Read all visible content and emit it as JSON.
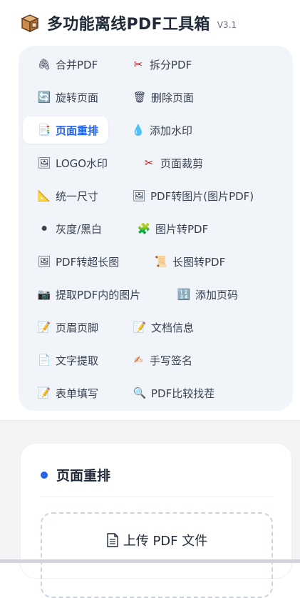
{
  "app": {
    "title": "多功能离线PDF工具箱",
    "version": "V3.1"
  },
  "tools": [
    {
      "label": "合并PDF",
      "icon": "paperclip-icon",
      "glyph": "🖇"
    },
    {
      "label": "拆分PDF",
      "icon": "scissors-icon",
      "glyph": "✂"
    },
    {
      "label": "旋转页面",
      "icon": "rotate-icon",
      "glyph": "🔄"
    },
    {
      "label": "删除页面",
      "icon": "trash-icon",
      "glyph": "🗑"
    },
    {
      "label": "页面重排",
      "icon": "reorder-page-icon",
      "glyph": "📑"
    },
    {
      "label": "添加水印",
      "icon": "droplet-icon",
      "glyph": "💧"
    },
    {
      "label": "LOGO水印",
      "icon": "picture-icon",
      "glyph": "🖼"
    },
    {
      "label": "页面裁剪",
      "icon": "scissors-icon",
      "glyph": "✂"
    },
    {
      "label": "统一尺寸",
      "icon": "ruler-icon",
      "glyph": "📐"
    },
    {
      "label": "PDF转图片(图片PDF)",
      "icon": "picture-icon",
      "glyph": "🖼"
    },
    {
      "label": "灰度/黑白",
      "icon": "black-circle-icon",
      "glyph": "⚫"
    },
    {
      "label": "图片转PDF",
      "icon": "puzzle-icon",
      "glyph": "🧩"
    },
    {
      "label": "PDF转超长图",
      "icon": "picture-icon",
      "glyph": "🖼"
    },
    {
      "label": "长图转PDF",
      "icon": "scroll-icon",
      "glyph": "📜"
    },
    {
      "label": "提取PDF内的图片",
      "icon": "camera-icon",
      "glyph": "📷"
    },
    {
      "label": "添加页码",
      "icon": "page-number-icon",
      "glyph": "🔢"
    },
    {
      "label": "页眉页脚",
      "icon": "memo-icon",
      "glyph": "📝"
    },
    {
      "label": "文档信息",
      "icon": "memo-icon",
      "glyph": "📝"
    },
    {
      "label": "文字提取",
      "icon": "text-page-icon",
      "glyph": "📄"
    },
    {
      "label": "手写签名",
      "icon": "pen-icon",
      "glyph": "✍"
    },
    {
      "label": "表单填写",
      "icon": "memo-icon",
      "glyph": "📝"
    },
    {
      "label": "PDF比较找茬",
      "icon": "magnifier-icon",
      "glyph": "🔍"
    }
  ],
  "active_tool": "页面重排",
  "panel": {
    "title": "页面重排",
    "upload_label": "上传 PDF 文件"
  },
  "colors": {
    "accent": "#2563eb",
    "panel_bg": "#f1f5f9"
  }
}
